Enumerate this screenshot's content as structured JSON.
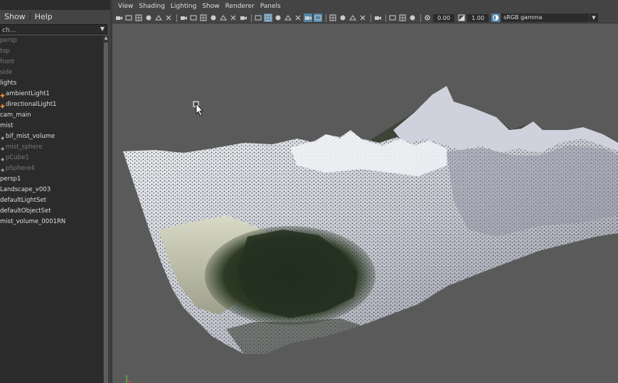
{
  "outliner": {
    "menu": [
      {
        "label": "Show"
      },
      {
        "label": "Help"
      }
    ],
    "search": {
      "value": "ch..."
    },
    "items": [
      {
        "label": "persp",
        "dim": true,
        "indent": false,
        "icon": ""
      },
      {
        "label": "top",
        "dim": true,
        "indent": false,
        "icon": ""
      },
      {
        "label": "front",
        "dim": true,
        "indent": false,
        "icon": ""
      },
      {
        "label": "side",
        "dim": true,
        "indent": false,
        "icon": ""
      },
      {
        "label": "lights",
        "dim": false,
        "indent": false,
        "icon": ""
      },
      {
        "label": "ambientLight1",
        "dim": false,
        "indent": true,
        "icon": "light-icon"
      },
      {
        "label": "directionalLight1",
        "dim": false,
        "indent": true,
        "icon": "light-icon"
      },
      {
        "label": "cam_main",
        "dim": false,
        "indent": false,
        "icon": ""
      },
      {
        "label": "mist",
        "dim": false,
        "indent": false,
        "icon": ""
      },
      {
        "label": "bif_mist_volume",
        "dim": false,
        "indent": true,
        "icon": "expand-icon"
      },
      {
        "label": "mist_sphere",
        "dim": true,
        "indent": true,
        "icon": "expand-icon"
      },
      {
        "label": "pCube1",
        "dim": true,
        "indent": true,
        "icon": "expand-icon"
      },
      {
        "label": "pSphere4",
        "dim": true,
        "indent": true,
        "icon": "expand-icon"
      },
      {
        "label": "persp1",
        "dim": false,
        "indent": false,
        "icon": ""
      },
      {
        "label": "Landscape_v003",
        "dim": false,
        "indent": false,
        "icon": ""
      },
      {
        "label": "defaultLightSet",
        "dim": false,
        "indent": false,
        "icon": ""
      },
      {
        "label": "defaultObjectSet",
        "dim": false,
        "indent": false,
        "icon": ""
      },
      {
        "label": "mist_volume_0001RN",
        "dim": false,
        "indent": false,
        "icon": ""
      }
    ]
  },
  "viewport": {
    "menu": [
      {
        "label": "View"
      },
      {
        "label": "Shading"
      },
      {
        "label": "Lighting"
      },
      {
        "label": "Show"
      },
      {
        "label": "Renderer"
      },
      {
        "label": "Panels"
      }
    ],
    "toolbar": {
      "groups": [
        [
          "camera-select-icon",
          "camera-attributes-icon",
          "bookmark-icon",
          "image-plane-icon",
          "2d-pan-zoom-icon",
          "grease-pencil-icon"
        ],
        [
          "grid-icon",
          "film-gate-icon",
          "resolution-gate-icon",
          "gate-mask-icon",
          "field-chart-icon",
          "safe-action-icon",
          "safe-title-icon"
        ],
        [
          "wireframe-icon",
          "smooth-shade-icon",
          "use-default-material-icon",
          "wireframe-on-shaded-icon",
          "textured-icon",
          "use-all-lights-icon",
          "shadows-icon"
        ],
        [
          "screen-space-ao-icon",
          "motion-blur-icon",
          "multisample-aa-icon",
          "depth-of-field-icon"
        ],
        [
          "isolate-select-icon"
        ],
        [
          "xray-icon",
          "xray-active-components-icon",
          "xray-joints-icon"
        ]
      ],
      "active": [
        "smooth-shade-icon",
        "use-all-lights-icon",
        "shadows-icon"
      ],
      "exposure_value": "0.00",
      "gamma_value": "1.00",
      "color_space": "sRGB gamma"
    },
    "colors": {
      "background": "#5a5a5a",
      "snow": "#e8e8ee",
      "snow_shadow": "#a9abb9",
      "rock": "#7d7f8c",
      "forest": "#24301e",
      "valley": "#cfd2b9"
    }
  }
}
